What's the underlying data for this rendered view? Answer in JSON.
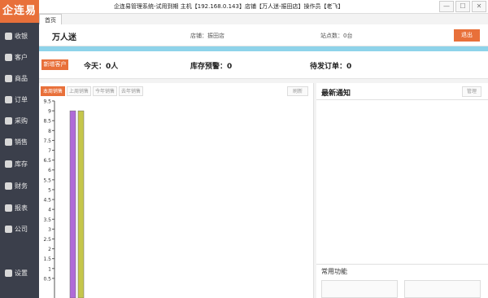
{
  "window": {
    "title": "企连易管理系统-试用到期 主机【192.168.0.143】店铺【万人迷-振田店】操作员【老飞】"
  },
  "brand": {
    "logo": "企连易"
  },
  "sidebar": {
    "items": [
      {
        "label": "收银",
        "icon": "cashier-icon"
      },
      {
        "label": "客户",
        "icon": "customer-icon"
      },
      {
        "label": "商品",
        "icon": "goods-icon"
      },
      {
        "label": "订单",
        "icon": "order-icon"
      },
      {
        "label": "采购",
        "icon": "cart-icon"
      },
      {
        "label": "销售",
        "icon": "sales-icon"
      },
      {
        "label": "库存",
        "icon": "inventory-icon"
      },
      {
        "label": "财务",
        "icon": "finance-icon"
      },
      {
        "label": "报表",
        "icon": "report-icon"
      },
      {
        "label": "公司",
        "icon": "company-icon"
      },
      {
        "label": "设置",
        "icon": "gear-icon"
      }
    ]
  },
  "tabs": [
    {
      "label": "首页"
    }
  ],
  "header": {
    "company": "万人迷",
    "store": "店铺：振田店",
    "site": "站点数：0台",
    "exit_label": "退出"
  },
  "stats": {
    "add_customer": "新增客户",
    "today": "今天：0人",
    "stock_warning": "库存预警：0",
    "pending_orders": "待发订单：0"
  },
  "chart_toolbar": {
    "buttons": [
      "本周销售",
      "上周销售",
      "今年销售",
      "去年销售"
    ],
    "active_index": 0,
    "refresh": "刷新"
  },
  "notice": {
    "title": "最新通知",
    "manage": "管理",
    "functions_title": "常用功能"
  },
  "colors": {
    "accent": "#e8703a",
    "sidebar": "#3b3f4b",
    "blue_bar": "#8ed3ea",
    "bar_purple": "#b06ad8",
    "bar_yellow": "#c5c64b"
  },
  "chart_data": {
    "type": "bar",
    "y_ticks": [
      "9.5",
      "9",
      "8.5",
      "8",
      "7.5",
      "7",
      "6.5",
      "6",
      "5.5",
      "5",
      "4.5",
      "4",
      "3.5",
      "3",
      "2.5",
      "2",
      "1.5",
      "1",
      "0.5"
    ],
    "ylim": [
      0.5,
      9.5
    ],
    "series": [
      {
        "values": [
          9.0
        ]
      },
      {
        "values": [
          9.0
        ]
      }
    ]
  }
}
